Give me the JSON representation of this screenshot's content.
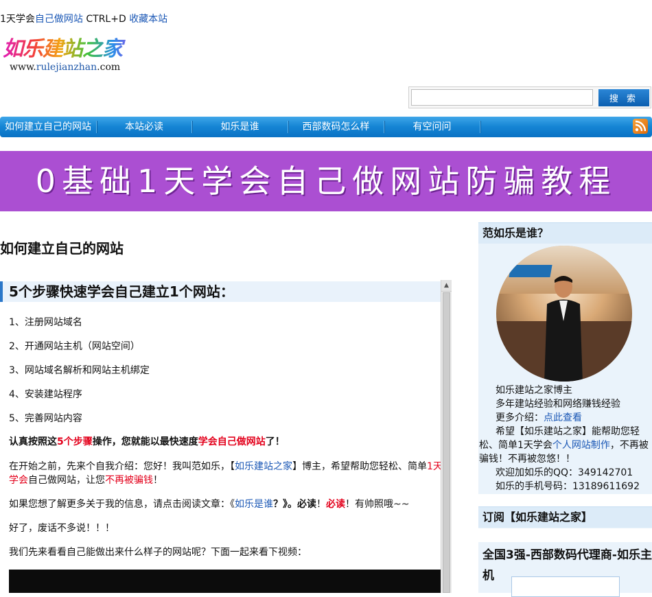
{
  "topbar": {
    "prefix": "1天学会",
    "link1": "自己做网站",
    "shortcut": " CTRL+D ",
    "link2": "收藏本站"
  },
  "logo": {
    "title": "如乐建站之家",
    "url_prefix": "www.",
    "url_mid": "rulejianzhan",
    "url_suffix": ".com"
  },
  "search": {
    "placeholder": "",
    "button_label": "搜 索"
  },
  "nav": {
    "items": [
      "如何建立自己的网站",
      "本站必读",
      "如乐是谁",
      "西部数码怎么样",
      "有空问问"
    ],
    "rss_icon": "rss-icon"
  },
  "banner": {
    "text": "0基础1天学会自己做网站防骗教程"
  },
  "main": {
    "page_title": "如何建立自己的网站",
    "section_heading": "5个步骤快速学会自己建立1个网站：",
    "steps": [
      "1、注册网站域名",
      "2、开通网站主机（网站空间）",
      "3、网站域名解析和网站主机绑定",
      "4、安装建站程序",
      "5、完善网站内容"
    ],
    "p1": {
      "a": "认真按照这",
      "b": "5个步骤",
      "c": "操作，您就能以最快速度",
      "d": "学会自己做网站",
      "e": "了！"
    },
    "p2": {
      "a": "在开始之前，先来个自我介绍：您好！我叫范如乐，【",
      "link": "如乐建站之家",
      "b": "】博主，希望帮助您轻松、简单",
      "red1": "1天",
      "red2": "学会",
      "c": "自己做网站，让您",
      "red3": "不再被骗钱",
      "d": "！"
    },
    "p3": {
      "a": "如果您想了解更多关于我的信息，请点击阅读文章：《",
      "link": "如乐是谁",
      "b": "？》。",
      "bold1": "必读",
      "c": "！",
      "red": "必读",
      "d": "！有帅照哦~~"
    },
    "p4": "好了，废话不多说！！！",
    "p5": "我们先来看看自己能做出来什么样子的网站呢？下面一起来看下视频："
  },
  "sidebar": {
    "about": {
      "title": "范如乐是谁？",
      "line1": "如乐建站之家博主",
      "line2": "多年建站经验和网络赚钱经验",
      "line3_prefix": "更多介绍：",
      "line3_link": "点此查看",
      "p_a": "希望【如乐建站之家】能帮助您轻",
      "p_b": "松、简单1天学会",
      "p_link": "个人网站制作",
      "p_c": "，不再被",
      "p_d": "骗钱！不再被忽悠！！",
      "qq": "欢迎加如乐的QQ：349142701",
      "phone": "如乐的手机号码：13189611692"
    },
    "subscribe": {
      "title": "订阅【如乐建站之家】"
    },
    "dealer": {
      "title_a": "全国3强-西部数码代理商-如乐主",
      "title_b": "机"
    }
  }
}
